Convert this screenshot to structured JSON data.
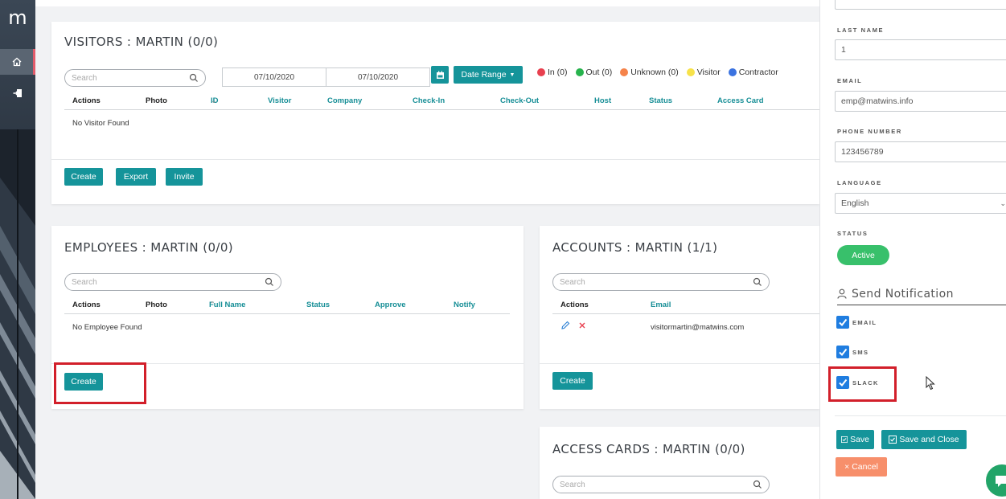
{
  "nav": {
    "logo": "m",
    "items": [
      {
        "icon": "home-icon"
      },
      {
        "icon": "sign-in-icon"
      }
    ]
  },
  "visitors": {
    "title": "VISITORS : MARTIN (0/0)",
    "search_placeholder": "Search",
    "date_from": "07/10/2020",
    "date_to": "07/10/2020",
    "date_range_label": "Date Range",
    "legend": [
      {
        "label": "In (0)",
        "color": "#e8404f"
      },
      {
        "label": "Out (0)",
        "color": "#27b34d"
      },
      {
        "label": "Unknown (0)",
        "color": "#f5834a"
      },
      {
        "label": "Visitor",
        "color": "#f7e24a"
      },
      {
        "label": "Contractor",
        "color": "#3b73e0"
      }
    ],
    "columns": [
      "Actions",
      "Photo",
      "ID",
      "Visitor",
      "Company",
      "Check-In",
      "Check-Out",
      "Host",
      "Status",
      "Access Card"
    ],
    "empty": "No Visitor Found",
    "buttons": {
      "create": "Create",
      "export": "Export",
      "invite": "Invite"
    }
  },
  "employees": {
    "title": "EMPLOYEES : MARTIN (0/0)",
    "search_placeholder": "Search",
    "columns": [
      "Actions",
      "Photo",
      "Full Name",
      "Status",
      "Approve",
      "Notify"
    ],
    "empty": "No Employee Found",
    "create": "Create"
  },
  "accounts": {
    "title": "ACCOUNTS : MARTIN (1/1)",
    "search_placeholder": "Search",
    "columns": [
      "Actions",
      "Email"
    ],
    "rows": [
      {
        "email": "visitormartin@matwins.com"
      }
    ],
    "create": "Create"
  },
  "access_cards": {
    "title": "ACCESS CARDS : MARTIN (0/0)",
    "search_placeholder": "Search"
  },
  "form": {
    "last_name_label": "LAST NAME",
    "last_name": "1",
    "email_label": "EMAIL",
    "email": "emp@matwins.info",
    "phone_label": "PHONE NUMBER",
    "phone": "123456789",
    "language_label": "LANGUAGE",
    "language": "English",
    "status_label": "STATUS",
    "status": "Active",
    "notification_title": "Send Notification",
    "checkboxes": [
      {
        "label": "EMAIL",
        "checked": true
      },
      {
        "label": "SMS",
        "checked": true
      },
      {
        "label": "SLACK",
        "checked": true
      }
    ],
    "save": "Save",
    "save_close": "Save and Close",
    "cancel": "Cancel"
  },
  "colors": {
    "teal": "#15949a",
    "active": "#38c06b",
    "cancel": "#f78f6b",
    "checkbox": "#1f7de0",
    "highlight": "#d21f2a"
  }
}
